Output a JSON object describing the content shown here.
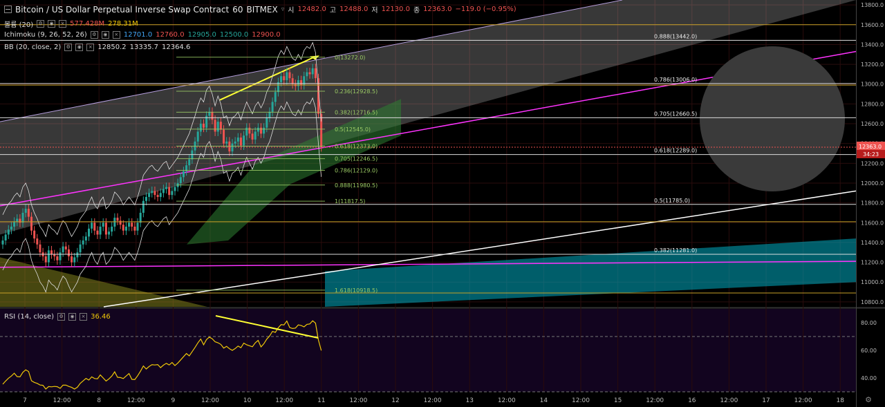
{
  "header": {
    "symbol": "Bitcoin / US Dollar Perpetual Inverse Swap Contract",
    "interval": "60",
    "exchange": "BITMEX",
    "open_label": "시",
    "open_value": "12482.0",
    "high_label": "고",
    "high_value": "12488.0",
    "low_label": "저",
    "low_value": "12130.0",
    "close_label": "종",
    "close_value": "12363.0",
    "change": "−119.0 (−0.95%)"
  },
  "indicators": {
    "volume": {
      "label": "볼륨 (20)",
      "v1": "577.428M",
      "v2": "278.31M"
    },
    "ichimoku": {
      "label": "Ichimoku (9, 26, 52, 26)",
      "v1": "12701.0",
      "v2": "12760.0",
      "v3": "12905.0",
      "v4": "12500.0",
      "v5": "12900.0"
    },
    "bb": {
      "label": "BB (20, close, 2)",
      "v1": "12850.2",
      "v2": "13335.7",
      "v3": "12364.6"
    },
    "rsi": {
      "label": "RSI (14, close)",
      "value": "36.46"
    }
  },
  "price_badge": {
    "price": "12363.0",
    "countdown": "34:23"
  },
  "colors": {
    "up": "#26a69a",
    "down": "#ef5350",
    "fib": "#9ccc65",
    "trend": "#ff33ff",
    "arrow": "#ffff33",
    "rsi": "#f0c808"
  },
  "chart_data": {
    "type": "candlestick",
    "price_axis": {
      "ticks": [
        "13800.0",
        "13600.0",
        "13400.0",
        "13200.0",
        "13000.0",
        "12800.0",
        "12600.0",
        "12400.0",
        "12200.0",
        "12000.0",
        "11800.0",
        "11600.0",
        "11400.0",
        "11200.0",
        "11000.0",
        "10800.0"
      ],
      "ylim": [
        10750,
        13850
      ]
    },
    "rsi_axis": {
      "ticks": [
        "80.00",
        "60.00",
        "40.00"
      ],
      "ylim": [
        30,
        90
      ]
    },
    "time_axis": {
      "ticks": [
        "7",
        "12:00",
        "8",
        "12:00",
        "9",
        "12:00",
        "10",
        "12:00",
        "11",
        "12:00",
        "12",
        "12:00",
        "13",
        "12:00",
        "14",
        "12:00",
        "15",
        "12:00",
        "16",
        "12:00",
        "17",
        "12:00",
        "18"
      ]
    },
    "fib_short": [
      {
        "label": "0(13272.0)",
        "price": 13272.0
      },
      {
        "label": "0.236(12928.5)",
        "price": 12928.5
      },
      {
        "label": "0.382(12716.5)",
        "price": 12716.5
      },
      {
        "label": "0.5(12545.0)",
        "price": 12545.0
      },
      {
        "label": "0.618(12373.0)",
        "price": 12373.0
      },
      {
        "label": "0.705(12246.5)",
        "price": 12246.5
      },
      {
        "label": "0.786(12129.0)",
        "price": 12129.0
      },
      {
        "label": "0.888(11980.5)",
        "price": 11980.5
      },
      {
        "label": "1(11817.5)",
        "price": 11817.5
      },
      {
        "label": "1.618(10918.5)",
        "price": 10918.5
      }
    ],
    "fib_long": [
      {
        "label": "0.888(13442.0)",
        "price": 13442.0
      },
      {
        "label": "0.786(13006.0)",
        "price": 13006.0
      },
      {
        "label": "0.705(12660.5)",
        "price": 12660.5
      },
      {
        "label": "0.618(12289.0)",
        "price": 12289.0
      },
      {
        "label": "0.5(11785.0)",
        "price": 11785.0
      },
      {
        "label": "0.382(11281.0)",
        "price": 11281.0
      }
    ],
    "closes": [
      11420,
      11480,
      11530,
      11560,
      11610,
      11640,
      11600,
      11700,
      11740,
      11660,
      11520,
      11440,
      11380,
      11300,
      11260,
      11200,
      11320,
      11280,
      11260,
      11220,
      11300,
      11360,
      11330,
      11260,
      11200,
      11250,
      11300,
      11380,
      11420,
      11460,
      11540,
      11600,
      11520,
      11480,
      11560,
      11600,
      11480,
      11510,
      11560,
      11650,
      11620,
      11580,
      11520,
      11560,
      11600,
      11560,
      11520,
      11600,
      11700,
      11820,
      11860,
      11900,
      11920,
      11880,
      11860,
      11900,
      11940,
      11960,
      11880,
      11920,
      11960,
      12000,
      12060,
      12120,
      12180,
      12240,
      12330,
      12420,
      12520,
      12600,
      12560,
      12680,
      12720,
      12640,
      12520,
      12620,
      12540,
      12400,
      12420,
      12320,
      12400,
      12420,
      12460,
      12380,
      12480,
      12560,
      12500,
      12440,
      12520,
      12560,
      12500,
      12560,
      12660,
      12720,
      12820,
      12920,
      13020,
      13080,
      13040,
      13120,
      13060,
      13000,
      12980,
      13040,
      12990,
      13080,
      13120,
      13100,
      13160,
      13060,
      12700,
      12363
    ]
  }
}
